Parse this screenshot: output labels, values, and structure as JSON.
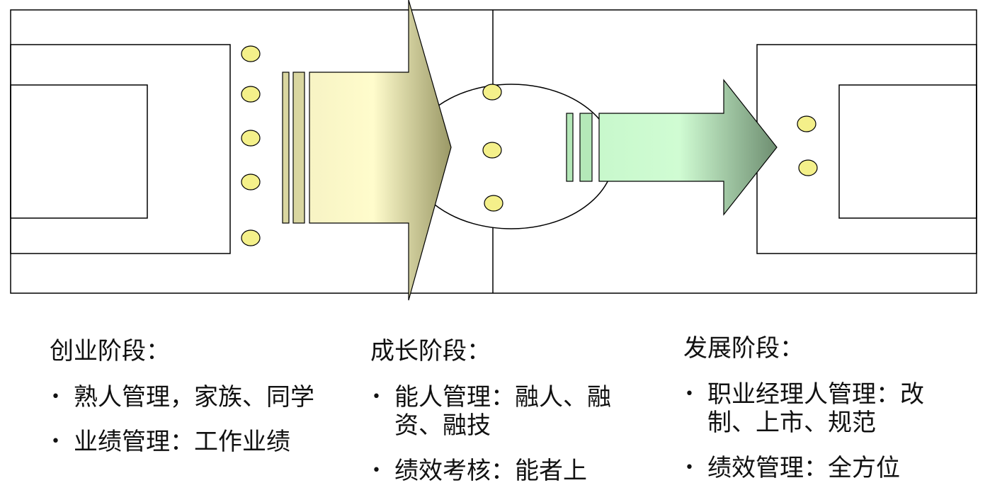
{
  "stages": [
    {
      "title": "创业阶段：",
      "items": [
        "熟人管理，家族、同学",
        "业绩管理：工作业绩"
      ]
    },
    {
      "title": "成长阶段：",
      "items": [
        "能人管理：融人、融资、融技",
        "绩效考核：能者上"
      ]
    },
    {
      "title": "发展阶段：",
      "items": [
        "职业经理人管理：改制、上市、规范",
        "绩效管理：全方位"
      ]
    }
  ],
  "bullet_char": "•",
  "colors": {
    "line": "#000000",
    "dot_fill": "#f4f08a",
    "big_arrow_light": "#fffccb",
    "big_arrow_dark": "#9c9a68",
    "small_arrow_light": "#cdfcd0",
    "small_arrow_dark": "#6f8f72"
  }
}
